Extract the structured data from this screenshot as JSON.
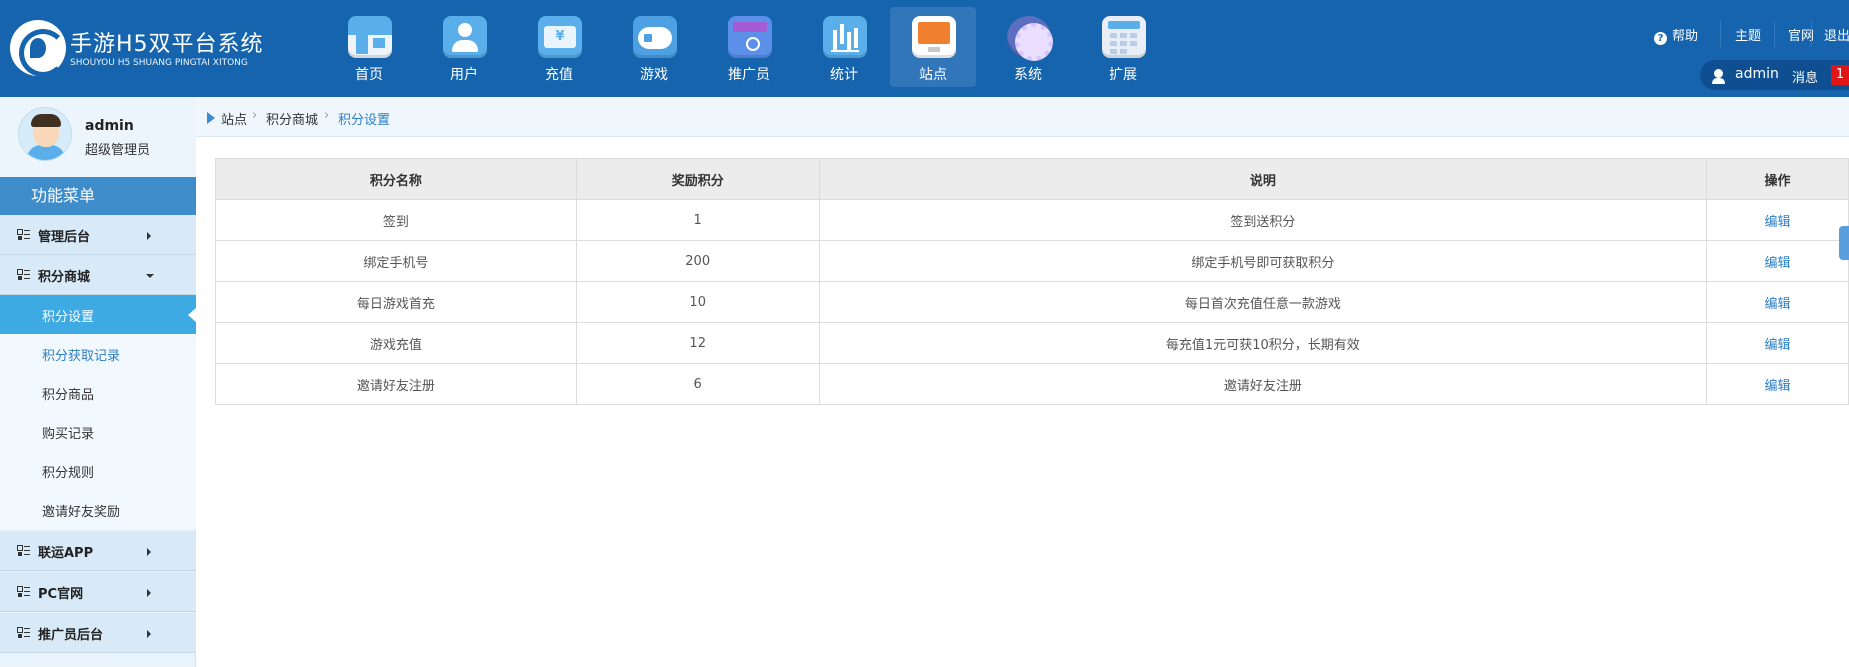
{
  "app": {
    "title": "手游H5双平台系统",
    "subtitle": "SHOUYOU H5 SHUANG PINGTAI XITONG"
  },
  "nav": [
    {
      "label": "首页",
      "icon": "storefront-icon"
    },
    {
      "label": "用户",
      "icon": "user-icon"
    },
    {
      "label": "充值",
      "icon": "wallet-icon"
    },
    {
      "label": "游戏",
      "icon": "gamepad-icon"
    },
    {
      "label": "推广员",
      "icon": "promoter-wallet-icon"
    },
    {
      "label": "统计",
      "icon": "bar-chart-icon"
    },
    {
      "label": "站点",
      "icon": "monitor-icon"
    },
    {
      "label": "系统",
      "icon": "settings-gear-icon"
    },
    {
      "label": "扩展",
      "icon": "calendar-grid-icon"
    }
  ],
  "nav_active": "站点",
  "toplinks": {
    "help": "帮助",
    "theme": "主题",
    "website": "官网",
    "logout": "退出"
  },
  "userbar": {
    "username": "admin",
    "messages_label": "消息",
    "messages_count": "1"
  },
  "profile": {
    "name": "admin",
    "role": "超级管理员"
  },
  "sidebar": {
    "menu_title": "功能菜单",
    "groups": [
      {
        "label": "管理后台",
        "expanded": false
      },
      {
        "label": "积分商城",
        "expanded": true
      },
      {
        "label": "联运APP",
        "expanded": false
      },
      {
        "label": "PC官网",
        "expanded": false
      },
      {
        "label": "推广员后台",
        "expanded": false
      }
    ],
    "subitems": [
      {
        "label": "积分设置",
        "active": true
      },
      {
        "label": "积分获取记录",
        "active": false
      },
      {
        "label": "积分商品",
        "active": false
      },
      {
        "label": "购买记录",
        "active": false
      },
      {
        "label": "积分规则",
        "active": false
      },
      {
        "label": "邀请好友奖励",
        "active": false
      }
    ]
  },
  "breadcrumb": [
    "站点",
    "积分商城",
    "积分设置"
  ],
  "table": {
    "headers": [
      "积分名称",
      "奖励积分",
      "说明",
      "操作"
    ],
    "rows": [
      {
        "name": "签到",
        "points": "1",
        "desc": "签到送积分",
        "action": "编辑"
      },
      {
        "name": "绑定手机号",
        "points": "200",
        "desc": "绑定手机号即可获取积分",
        "action": "编辑"
      },
      {
        "name": "每日游戏首充",
        "points": "10",
        "desc": "每日首次充值任意一款游戏",
        "action": "编辑"
      },
      {
        "name": "游戏充值",
        "points": "12",
        "desc": "每充值1元可获10积分，长期有效",
        "action": "编辑"
      },
      {
        "name": "邀请好友注册",
        "points": "6",
        "desc": "邀请好友注册",
        "action": "编辑"
      }
    ]
  },
  "colors": {
    "header": "#1664ad",
    "accent": "#3eaae4",
    "link": "#2d7ec4",
    "badge": "#e01515"
  }
}
